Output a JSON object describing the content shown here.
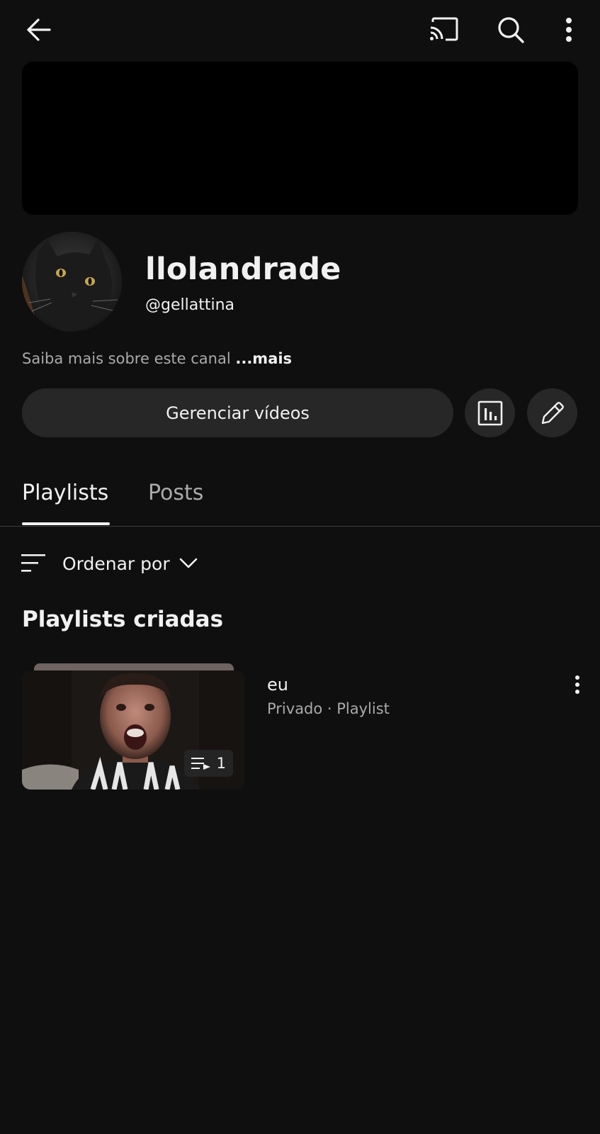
{
  "top_bar": {
    "back_icon": "arrow-back-icon",
    "cast_icon": "cast-icon",
    "search_icon": "search-icon",
    "more_icon": "more-vertical-icon"
  },
  "channel": {
    "name": "llolandrade",
    "handle": "@gellattina",
    "about_text": "Saiba mais sobre este canal",
    "about_more": "...mais"
  },
  "actions": {
    "manage_videos_label": "Gerenciar vídeos",
    "analytics_icon": "analytics-icon",
    "edit_icon": "pencil-icon"
  },
  "tabs": [
    {
      "label": "Playlists",
      "active": true
    },
    {
      "label": "Posts",
      "active": false
    }
  ],
  "sort": {
    "label": "Ordenar por",
    "icon": "sort-icon"
  },
  "section_title": "Playlists criadas",
  "playlists": [
    {
      "title": "eu",
      "meta": "Privado · Playlist",
      "video_count": "1"
    }
  ],
  "colors": {
    "background": "#0f0f0f",
    "surface": "#272727",
    "text_primary": "#f1f1f1",
    "text_secondary": "#aaaaaa"
  }
}
